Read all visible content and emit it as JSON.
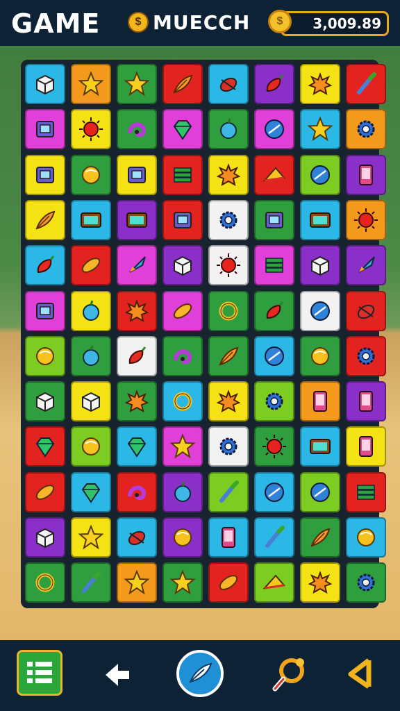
{
  "header": {
    "title": "GAME",
    "player_name": "MUECCH",
    "player_icon": "coin-badge-icon",
    "score": "3,009.89",
    "score_icon": "gold-coin-icon"
  },
  "colors": {
    "yellow": "#f5e214",
    "orange": "#f39a1c",
    "red": "#e3231f",
    "green": "#2f9e3e",
    "lime": "#7ccc22",
    "cyan": "#2cb8e6",
    "purple": "#8a2fc7",
    "magenta": "#e040d8",
    "white": "#f2f2f2"
  },
  "board": {
    "rows": [
      [
        {
          "c": "cyan",
          "i": "cube"
        },
        {
          "c": "orange",
          "i": "star"
        },
        {
          "c": "green",
          "i": "star"
        },
        {
          "c": "red",
          "i": "feather"
        },
        {
          "c": "cyan",
          "i": "bug"
        },
        {
          "c": "purple",
          "i": "pepper"
        },
        {
          "c": "yellow",
          "i": "splat"
        },
        {
          "c": "red",
          "i": "brush"
        }
      ],
      [
        {
          "c": "magenta",
          "i": "box"
        },
        {
          "c": "yellow",
          "i": "sun"
        },
        {
          "c": "green",
          "i": "magnet"
        },
        {
          "c": "magenta",
          "i": "gem"
        },
        {
          "c": "green",
          "i": "apple"
        },
        {
          "c": "magenta",
          "i": "orb"
        },
        {
          "c": "cyan",
          "i": "star"
        },
        {
          "c": "orange",
          "i": "gear"
        }
      ],
      [
        {
          "c": "yellow",
          "i": "box"
        },
        {
          "c": "green",
          "i": "ball"
        },
        {
          "c": "yellow",
          "i": "box"
        },
        {
          "c": "red",
          "i": "stack"
        },
        {
          "c": "yellow",
          "i": "splat"
        },
        {
          "c": "red",
          "i": "hat"
        },
        {
          "c": "lime",
          "i": "orb"
        },
        {
          "c": "purple",
          "i": "phone"
        }
      ],
      [
        {
          "c": "yellow",
          "i": "feather"
        },
        {
          "c": "cyan",
          "i": "tv"
        },
        {
          "c": "purple",
          "i": "tv"
        },
        {
          "c": "red",
          "i": "box"
        },
        {
          "c": "white",
          "i": "gear"
        },
        {
          "c": "green",
          "i": "box"
        },
        {
          "c": "cyan",
          "i": "tv"
        },
        {
          "c": "orange",
          "i": "sun"
        }
      ],
      [
        {
          "c": "cyan",
          "i": "pepper"
        },
        {
          "c": "red",
          "i": "bean"
        },
        {
          "c": "magenta",
          "i": "rocket"
        },
        {
          "c": "purple",
          "i": "cube"
        },
        {
          "c": "white",
          "i": "sun"
        },
        {
          "c": "magenta",
          "i": "stack"
        },
        {
          "c": "purple",
          "i": "cube"
        },
        {
          "c": "purple",
          "i": "rocket"
        }
      ],
      [
        {
          "c": "magenta",
          "i": "box"
        },
        {
          "c": "yellow",
          "i": "apple"
        },
        {
          "c": "red",
          "i": "splat"
        },
        {
          "c": "magenta",
          "i": "bean"
        },
        {
          "c": "green",
          "i": "ring"
        },
        {
          "c": "green",
          "i": "pepper"
        },
        {
          "c": "white",
          "i": "orb"
        },
        {
          "c": "red",
          "i": "bug"
        }
      ],
      [
        {
          "c": "lime",
          "i": "ball"
        },
        {
          "c": "green",
          "i": "apple"
        },
        {
          "c": "white",
          "i": "pepper"
        },
        {
          "c": "green",
          "i": "magnet"
        },
        {
          "c": "green",
          "i": "feather"
        },
        {
          "c": "cyan",
          "i": "orb"
        },
        {
          "c": "green",
          "i": "ball"
        },
        {
          "c": "red",
          "i": "gear"
        }
      ],
      [
        {
          "c": "green",
          "i": "cube"
        },
        {
          "c": "yellow",
          "i": "cube"
        },
        {
          "c": "green",
          "i": "splat"
        },
        {
          "c": "cyan",
          "i": "ring"
        },
        {
          "c": "yellow",
          "i": "splat"
        },
        {
          "c": "lime",
          "i": "gear"
        },
        {
          "c": "orange",
          "i": "phone"
        },
        {
          "c": "purple",
          "i": "phone"
        }
      ],
      [
        {
          "c": "red",
          "i": "gem"
        },
        {
          "c": "lime",
          "i": "ball"
        },
        {
          "c": "cyan",
          "i": "gem"
        },
        {
          "c": "magenta",
          "i": "star"
        },
        {
          "c": "white",
          "i": "gear"
        },
        {
          "c": "green",
          "i": "sun"
        },
        {
          "c": "cyan",
          "i": "tv"
        },
        {
          "c": "yellow",
          "i": "phone"
        }
      ],
      [
        {
          "c": "red",
          "i": "bean"
        },
        {
          "c": "cyan",
          "i": "gem"
        },
        {
          "c": "red",
          "i": "magnet"
        },
        {
          "c": "purple",
          "i": "apple"
        },
        {
          "c": "lime",
          "i": "brush"
        },
        {
          "c": "cyan",
          "i": "orb"
        },
        {
          "c": "lime",
          "i": "orb"
        },
        {
          "c": "red",
          "i": "stack"
        }
      ],
      [
        {
          "c": "purple",
          "i": "cube"
        },
        {
          "c": "yellow",
          "i": "star"
        },
        {
          "c": "cyan",
          "i": "bug"
        },
        {
          "c": "purple",
          "i": "ball"
        },
        {
          "c": "cyan",
          "i": "phone"
        },
        {
          "c": "cyan",
          "i": "brush"
        },
        {
          "c": "green",
          "i": "feather"
        },
        {
          "c": "cyan",
          "i": "ball"
        }
      ],
      [
        {
          "c": "green",
          "i": "ring"
        },
        {
          "c": "green",
          "i": "brush"
        },
        {
          "c": "orange",
          "i": "star"
        },
        {
          "c": "green",
          "i": "star"
        },
        {
          "c": "red",
          "i": "bean"
        },
        {
          "c": "lime",
          "i": "hat"
        },
        {
          "c": "yellow",
          "i": "splat"
        },
        {
          "c": "green",
          "i": "gear"
        }
      ]
    ]
  },
  "toolbar": [
    {
      "name": "menu-button",
      "icon": "list-icon"
    },
    {
      "name": "back-button",
      "icon": "arrow-left-icon"
    },
    {
      "name": "center-action-button",
      "icon": "feather-icon"
    },
    {
      "name": "hint-button",
      "icon": "magnifier-icon"
    },
    {
      "name": "share-button",
      "icon": "share-icon"
    }
  ]
}
